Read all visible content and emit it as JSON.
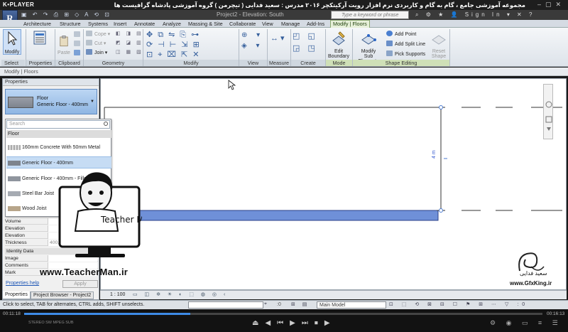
{
  "player": {
    "brand": "K•PLAYER",
    "title": "مجموعه آموزشی جامع ، گام به گام و کاربردی نرم افزار رویت آرکیتکچر ۲۰۱۶   مدرس : سعید فدایی ( تیچرمن ) گروه آموزشی پادشاه گرافیست ها",
    "time_current": "00:11:18",
    "time_total": "00:16:13",
    "progress": 0.32,
    "tags": "STEREO  SW  MPEG  SUB"
  },
  "revit": {
    "doc_title": "Project2 - Elevation: South",
    "search_placeholder": "Type a keyword or phrase",
    "sign_in": "Sign In",
    "app_menu": "R"
  },
  "tabs": [
    "Architecture",
    "Structure",
    "Systems",
    "Insert",
    "Annotate",
    "Analyze",
    "Massing & Site",
    "Collaborate",
    "View",
    "Manage",
    "Add-Ins",
    "Modify | Floors"
  ],
  "ribbon": {
    "modify": "Modify",
    "properties": "Properties",
    "paste": "Paste",
    "cope": "Cope",
    "cut": "Cut",
    "join": "Join",
    "edit_boundary_1": "Edit",
    "edit_boundary_2": "Boundary",
    "modify_sub_1": "Modify",
    "modify_sub_2": "Sub Elements",
    "add_point": "Add Point",
    "add_split_line": "Add Split Line",
    "pick_supports": "Pick Supports",
    "reset_shape_1": "Reset",
    "reset_shape_2": "Shape",
    "groups": {
      "select": "Select",
      "properties": "Properties",
      "clipboard": "Clipboard",
      "geometry": "Geometry",
      "modify": "Modify",
      "view": "View",
      "measure": "Measure",
      "create": "Create",
      "mode": "Mode",
      "shape_editing": "Shape Editing"
    }
  },
  "context_bar": "Modify | Floors",
  "properties": {
    "header": "Properties",
    "type_family": "Floor",
    "type_name": "Generic Floor - 400mm",
    "search_placeholder": "Search",
    "category": "Floor",
    "items": [
      "160mm Concrete With 50mm Metal Deck",
      "Generic Floor - 400mm",
      "Generic Floor - 400mm - Filled",
      "Steel Bar Joist",
      "Wood Joist"
    ],
    "rows": [
      "Volume",
      "Elevation",
      "Elevation",
      "Thickness"
    ],
    "thickness_value": "400.0",
    "identity_section": "Identity Data",
    "identity_rows": [
      "Image",
      "Comments",
      "Mark"
    ],
    "help": "Properties help",
    "apply": "Apply"
  },
  "bottom_tabs": [
    "Properties",
    "Project Browser - Project2"
  ],
  "drawing": {
    "dimension": "4 m"
  },
  "view_bar": {
    "scale": "1 : 100"
  },
  "status": {
    "message": "Click to select, TAB for alternates, CTRL adds, SHIFT unselects.",
    "coord": ":0",
    "model": "Main Model"
  },
  "watermark": {
    "teacherman_site": "www.TeacherMan.ir",
    "gfx_site": "www.GfxKing.ir",
    "gfx_name": "سعید فدایی"
  }
}
